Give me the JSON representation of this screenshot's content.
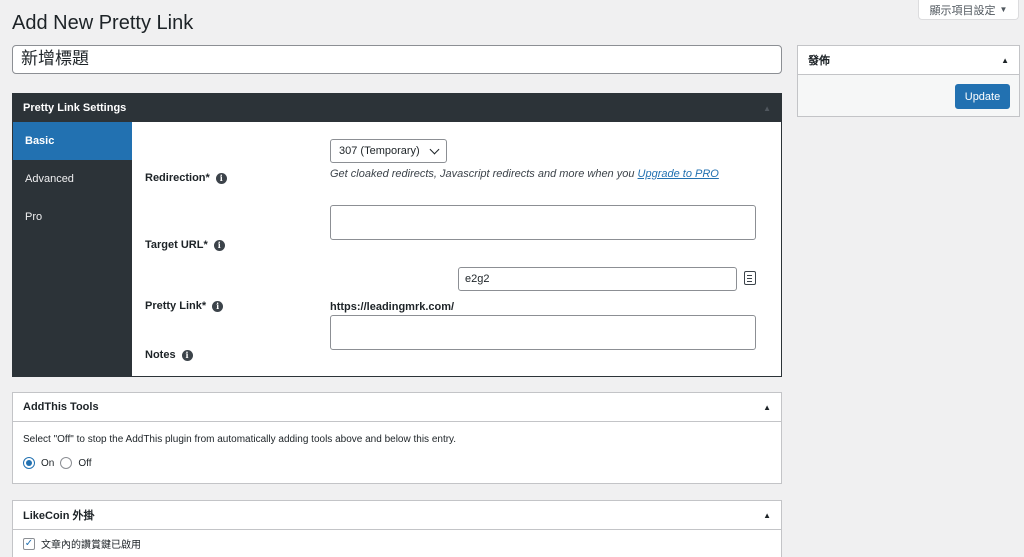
{
  "header": {
    "title": "Add New Pretty Link",
    "screen_options": "顯示項目設定",
    "screen_options_arrow": "▼"
  },
  "title_input": {
    "value": "新增標題"
  },
  "settings": {
    "title": "Pretty Link Settings",
    "tabs": [
      {
        "label": "Basic",
        "active": true
      },
      {
        "label": "Advanced",
        "active": false
      },
      {
        "label": "Pro",
        "active": false
      }
    ],
    "redirection": {
      "label": "Redirection*",
      "selected": "307 (Temporary)",
      "hint": "Get cloaked redirects, Javascript redirects and more when you ",
      "hint_link": "Upgrade to PRO"
    },
    "target_url": {
      "label": "Target URL*",
      "value": ""
    },
    "pretty_link": {
      "label": "Pretty Link*",
      "base_url": "https://leadingmrk.com/",
      "slug": "e2g2"
    },
    "notes": {
      "label": "Notes",
      "value": ""
    }
  },
  "addthis": {
    "title": "AddThis Tools",
    "description": "Select \"Off\" to stop the AddThis plugin from automatically adding tools above and below this entry.",
    "on_label": "On",
    "off_label": "Off",
    "selected": "On"
  },
  "likecoin": {
    "title": "LikeCoin 外掛",
    "checkbox_label": "文章內的讚賞鍵已啟用",
    "checked": true
  },
  "publish": {
    "title": "發佈",
    "update_label": "Update"
  },
  "icons": {
    "info": "info-icon",
    "collapse": "arrow-up-icon",
    "copy": "clipboard-icon"
  },
  "colors": {
    "accent": "#2271b1",
    "dark_panel": "#2c3338",
    "background": "#f0f0f1"
  }
}
